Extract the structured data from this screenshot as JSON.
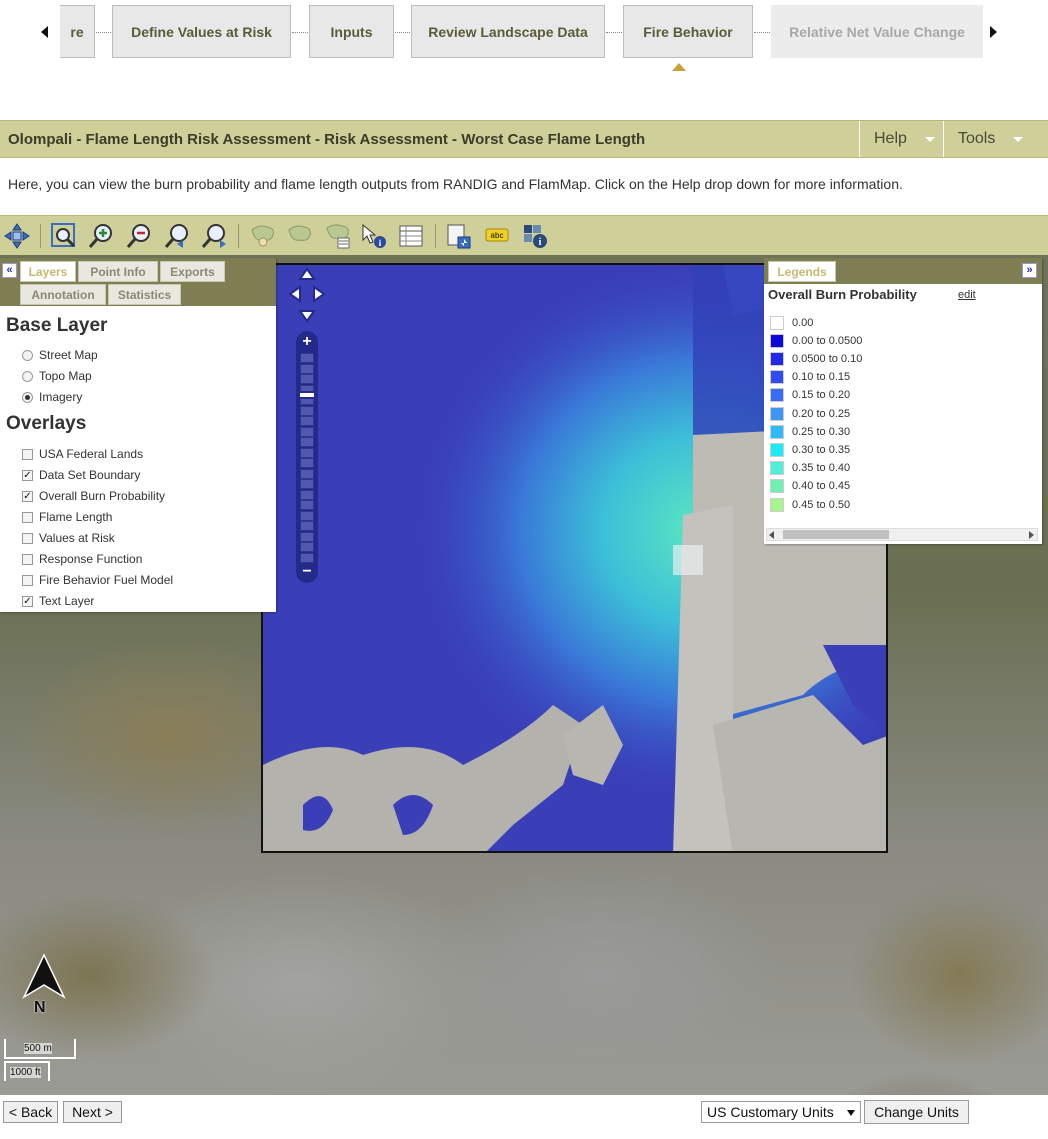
{
  "wizard": {
    "steps": [
      {
        "label": "re",
        "state": "normal"
      },
      {
        "label": "Define Values at Risk",
        "state": "normal"
      },
      {
        "label": "Inputs",
        "state": "normal"
      },
      {
        "label": "Review Landscape Data",
        "state": "normal"
      },
      {
        "label": "Fire Behavior",
        "state": "current"
      },
      {
        "label": "Relative Net Value Change",
        "state": "disabled"
      }
    ]
  },
  "header": {
    "title": "Olompali - Flame Length Risk Assessment - Risk Assessment - Worst Case Flame Length",
    "help_label": "Help",
    "tools_label": "Tools"
  },
  "intro_text": "Here, you can view the burn probability and flame length outputs from RANDIG and FlamMap. Click on the Help drop down for more information.",
  "toolbar": {
    "icons": [
      "pan-icon",
      "zoom-extent-icon",
      "zoom-in-icon",
      "zoom-out-icon",
      "zoom-previous-icon",
      "zoom-next-icon",
      "select-polygon-icon",
      "select-freehand-icon",
      "select-attribute-icon",
      "identify-icon",
      "attribute-table-icon",
      "export-map-icon",
      "label-icon",
      "info-grid-icon"
    ]
  },
  "layers_panel": {
    "tabs": [
      "Layers",
      "Point Info",
      "Exports",
      "Annotation",
      "Statistics"
    ],
    "base_layer_heading": "Base Layer",
    "base_layers": [
      {
        "label": "Street Map",
        "selected": false
      },
      {
        "label": "Topo Map",
        "selected": false
      },
      {
        "label": "Imagery",
        "selected": true
      }
    ],
    "overlays_heading": "Overlays",
    "overlays": [
      {
        "label": "USA Federal Lands",
        "checked": false
      },
      {
        "label": "Data Set Boundary",
        "checked": true
      },
      {
        "label": "Overall Burn Probability",
        "checked": true
      },
      {
        "label": "Flame Length",
        "checked": false
      },
      {
        "label": "Values at Risk",
        "checked": false
      },
      {
        "label": "Response Function",
        "checked": false
      },
      {
        "label": "Fire Behavior Fuel Model",
        "checked": false
      },
      {
        "label": "Text Layer",
        "checked": true
      }
    ]
  },
  "legend_panel": {
    "tab_label": "Legends",
    "title": "Overall Burn Probability",
    "edit_label": "edit",
    "entries": [
      {
        "label": "0.00",
        "color": "#ffffff"
      },
      {
        "label": "0.00 to 0.0500",
        "color": "#0a0adc"
      },
      {
        "label": "0.0500 to 0.10",
        "color": "#2328e8"
      },
      {
        "label": "0.10 to 0.15",
        "color": "#2e4cf0"
      },
      {
        "label": "0.15 to 0.20",
        "color": "#3a6cf4"
      },
      {
        "label": "0.20 to 0.25",
        "color": "#3d98f4"
      },
      {
        "label": "0.25 to 0.30",
        "color": "#2ebcf6"
      },
      {
        "label": "0.30 to 0.35",
        "color": "#1eeaf4"
      },
      {
        "label": "0.35 to 0.40",
        "color": "#4ef0d8"
      },
      {
        "label": "0.40 to 0.45",
        "color": "#6ef0b0"
      },
      {
        "label": "0.45 to 0.50",
        "color": "#a8f48e"
      }
    ]
  },
  "map": {
    "north_label": "N",
    "scale_metric": "500 m",
    "scale_imperial": "1000 ft"
  },
  "footer": {
    "back_label": "< Back",
    "next_label": "Next >",
    "units_selected": "US Customary Units",
    "change_units_label": "Change Units"
  }
}
